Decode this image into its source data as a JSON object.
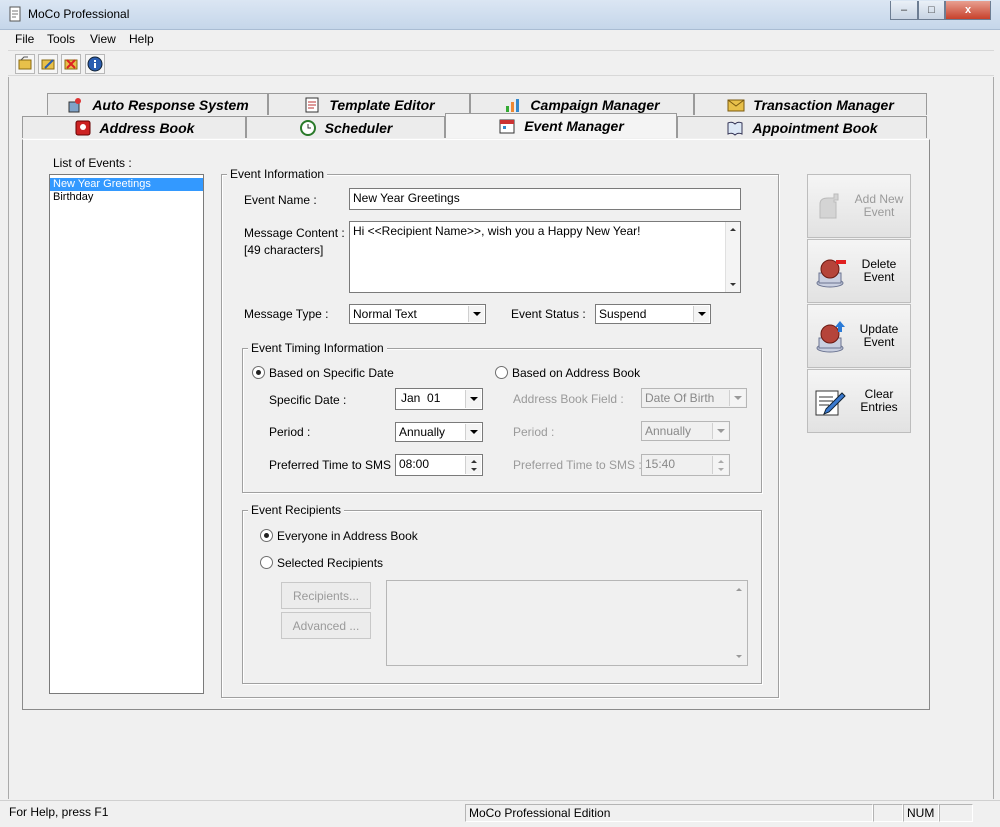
{
  "window": {
    "title": "MoCo Professional",
    "min": "–",
    "max": "□",
    "close": "x"
  },
  "menu": [
    "File",
    "Tools",
    "View",
    "Help"
  ],
  "tabs": {
    "row1": [
      "Auto Response System",
      "Template Editor",
      "Campaign Manager",
      "Transaction Manager"
    ],
    "row2": [
      "Address Book",
      "Scheduler",
      "Event Manager",
      "Appointment Book"
    ]
  },
  "events_list": {
    "label": "List of Events :",
    "items": [
      "New Year Greetings",
      "Birthday"
    ]
  },
  "event_info": {
    "title": "Event Information",
    "name_label": "Event Name :",
    "name_value": "New Year Greetings",
    "content_label": "Message Content :",
    "char_count": "[49 characters]",
    "content_value": "Hi <<Recipient Name>>, wish you a Happy New Year!",
    "type_label": "Message Type :",
    "type_value": "Normal Text",
    "status_label": "Event Status :",
    "status_value": "Suspend"
  },
  "timing": {
    "title": "Event Timing Information",
    "specific_radio": "Based on Specific Date",
    "address_radio": "Based on Address Book",
    "specific_date_label": "Specific Date :",
    "specific_date_value": "Jan  01",
    "period_label": "Period :",
    "period_value": "Annually",
    "time_label": "Preferred Time to SMS :",
    "time_value": "08:00",
    "ab_field_label": "Address Book Field :",
    "ab_field_value": "Date Of Birth",
    "ab_period_label": "Period :",
    "ab_period_value": "Annually",
    "ab_time_label": "Preferred Time to SMS :",
    "ab_time_value": "15:40"
  },
  "recipients": {
    "title": "Event Recipients",
    "everyone": "Everyone in Address Book",
    "selected": "Selected Recipients",
    "recipients_btn": "Recipients...",
    "advanced_btn": "Advanced ..."
  },
  "actions": {
    "add": [
      "Add New",
      "Event"
    ],
    "delete": [
      "Delete",
      "Event"
    ],
    "update": [
      "Update",
      "Event"
    ],
    "clear": [
      "Clear",
      "Entries"
    ]
  },
  "status": {
    "help": "For Help, press F1",
    "edition": "MoCo Professional Edition",
    "num": "NUM"
  },
  "colors": {
    "selection": "#3399ff",
    "titlebar": "#c5d6ea"
  }
}
